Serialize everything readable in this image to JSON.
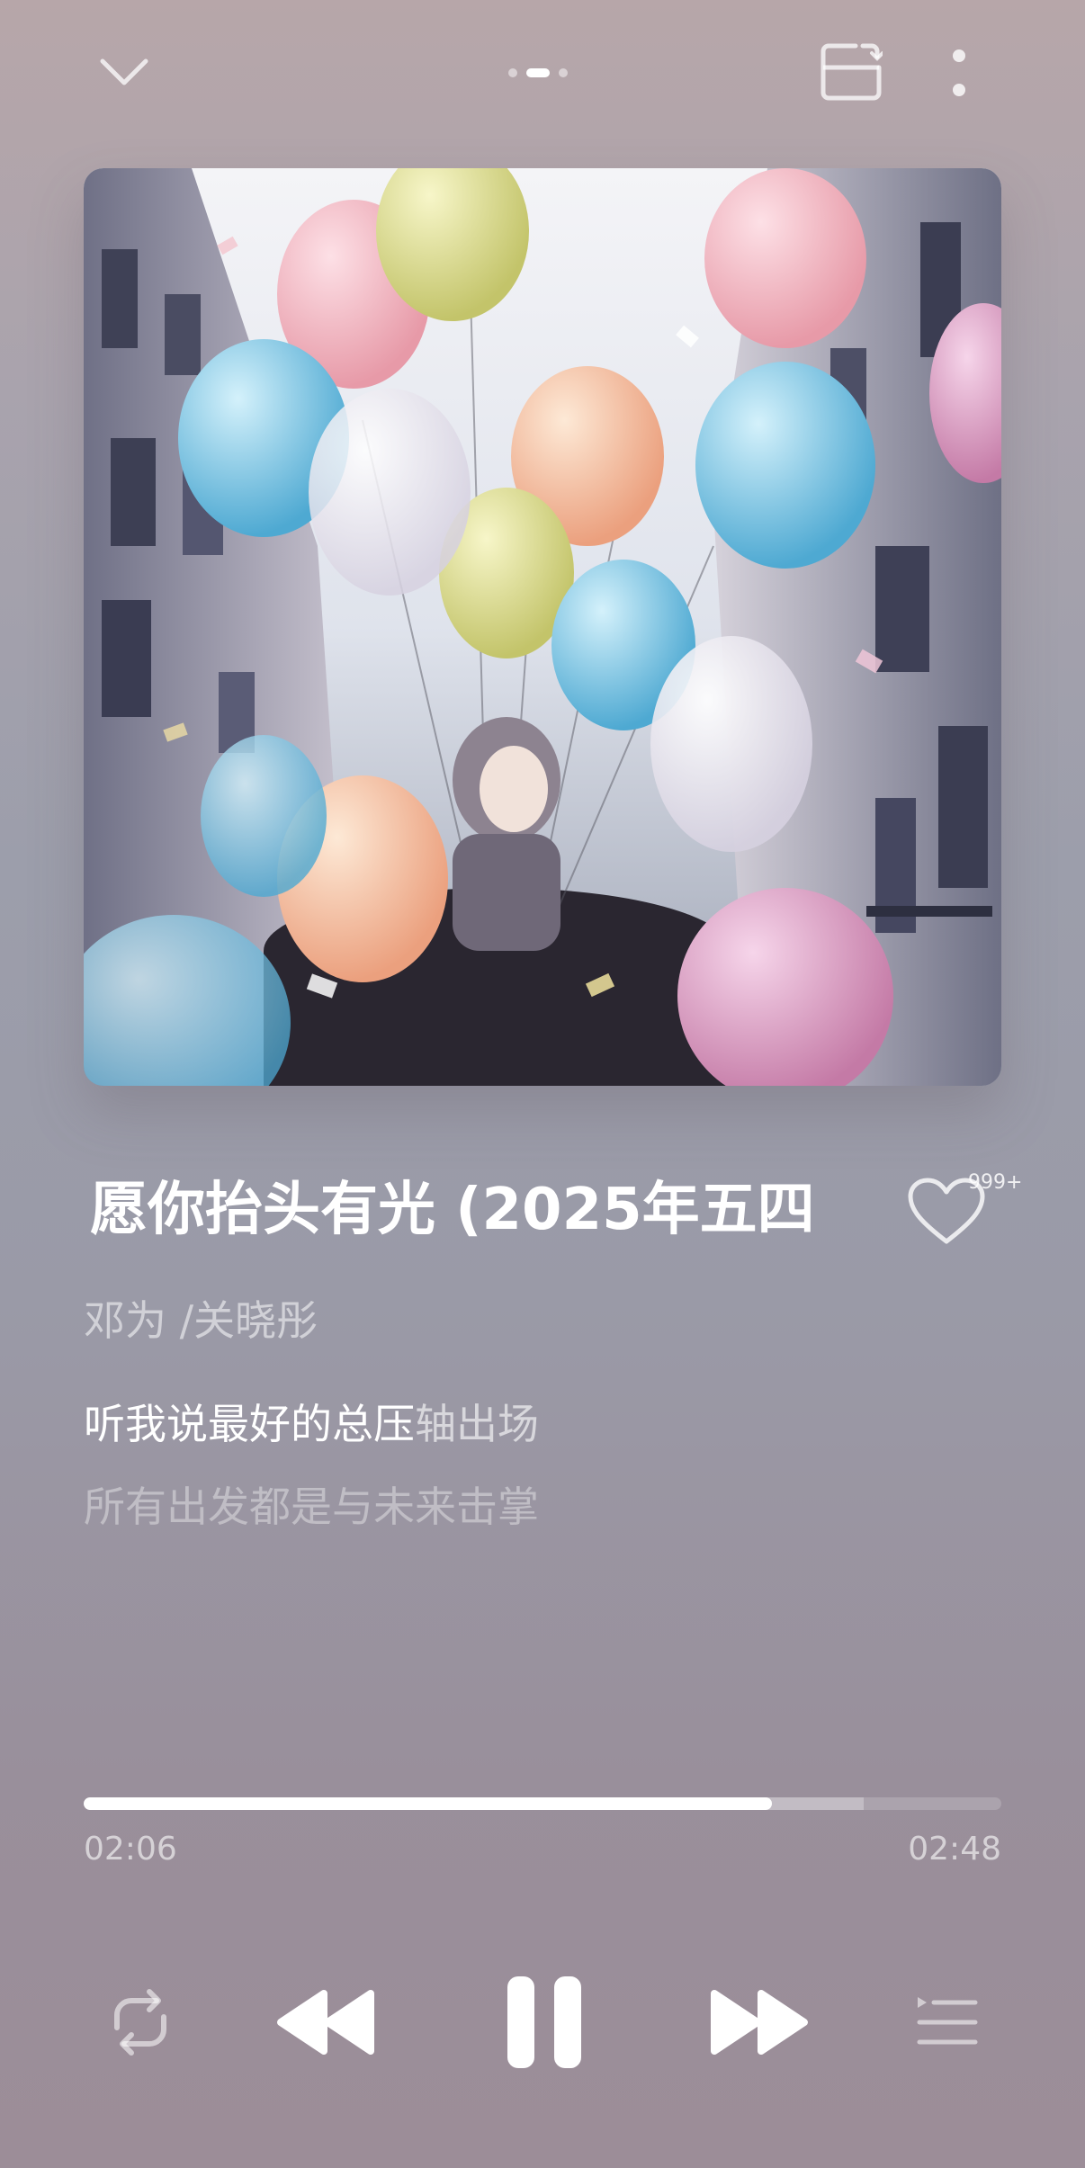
{
  "player": {
    "title": "愿你抬头有光 (2025年五四",
    "artist": "邓为 /关晓彤",
    "like_count": "999+",
    "lyrics": {
      "current_sung": "听我说最好的总压",
      "current_unsung": "轴出场",
      "next": "所有出发都是与未来击掌"
    },
    "time_elapsed": "02:06",
    "time_total": "02:48",
    "progress": 0.75,
    "buffered": 0.85,
    "page_indicator": {
      "count": 3,
      "active": 1
    }
  },
  "icons": {
    "collapse": "chevron-down-icon",
    "cast": "device-switch-icon",
    "more": "more-vertical-icon",
    "like": "heart-icon",
    "repeat": "repeat-icon",
    "previous": "previous-icon",
    "pause": "pause-icon",
    "next": "next-icon",
    "playlist": "playlist-icon"
  }
}
